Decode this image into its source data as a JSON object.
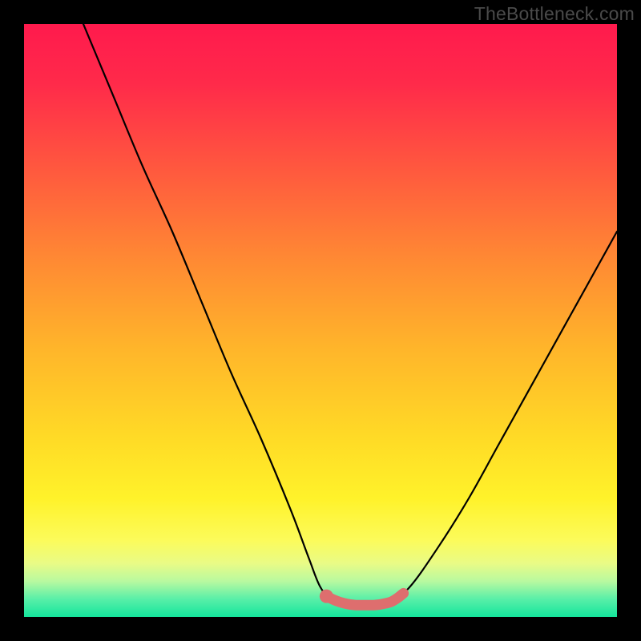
{
  "watermark": "TheBottleneck.com",
  "colors": {
    "black": "#000000",
    "curve_stroke": "#000000",
    "dot_fill": "#de6e6e",
    "gradient_top": "#ff1a4d",
    "gradient_bottom": "#14e59c"
  },
  "chart_data": {
    "type": "line",
    "title": "",
    "xlabel": "",
    "ylabel": "",
    "xlim": [
      0,
      100
    ],
    "ylim": [
      0,
      100
    ],
    "grid": false,
    "legend": false,
    "annotations": [],
    "series": [
      {
        "name": "bottleneck-curve",
        "x": [
          10,
          15,
          20,
          25,
          30,
          35,
          40,
          45,
          48,
          50,
          52,
          55,
          58,
          60,
          62,
          65,
          70,
          75,
          80,
          85,
          90,
          95,
          100
        ],
        "y": [
          100,
          88,
          76,
          65,
          53,
          41,
          30,
          18,
          10,
          5,
          3,
          2,
          2,
          2,
          3,
          5,
          12,
          20,
          29,
          38,
          47,
          56,
          65
        ]
      },
      {
        "name": "highlighted-minimum-band",
        "x": [
          51,
          52,
          53,
          54,
          55,
          56,
          57,
          58,
          59,
          60,
          61,
          62,
          63,
          64
        ],
        "y": [
          3.5,
          3.0,
          2.6,
          2.3,
          2.1,
          2.0,
          2.0,
          2.0,
          2.0,
          2.1,
          2.3,
          2.6,
          3.2,
          4.0
        ]
      }
    ],
    "marker_point": {
      "x": 51,
      "y": 3.5
    }
  }
}
